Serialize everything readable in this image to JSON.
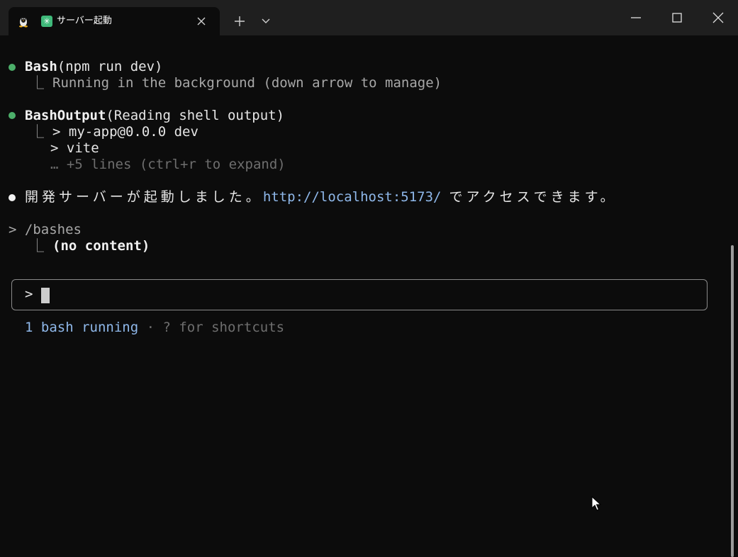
{
  "window": {
    "tab_title": "サーバー起動",
    "tab_app_icon_glyph": "✳",
    "icons": {
      "tab_profile": "linux-tux-icon",
      "tab_app": "asterisk-icon",
      "tab_close": "close-icon",
      "new_tab": "plus-icon",
      "tab_dropdown": "chevron-down-icon",
      "minimize": "minimize-icon",
      "maximize": "maximize-icon",
      "close": "close-icon"
    }
  },
  "terminal": {
    "tree_glyph": "⎿",
    "blocks": {
      "bash": {
        "tool": "Bash",
        "args": "(npm run dev)",
        "result": "Running in the background (down arrow to manage)"
      },
      "bash_output": {
        "tool": "BashOutput",
        "args": "(Reading shell output)",
        "line1": "> my-app@0.0.0 dev",
        "line2": "> vite",
        "more": "… +5 lines (ctrl+r to expand)"
      },
      "message": {
        "prefix": "開発サーバーが起動しました。",
        "url": "http://localhost:5173/",
        "suffix": " でアクセスできます。"
      },
      "command": {
        "text": "> /bashes",
        "result": "(no content)"
      }
    },
    "input": {
      "prompt": ">",
      "value": ""
    },
    "status": {
      "running": "1 bash running",
      "separator": " · ",
      "hint": "? for shortcuts"
    }
  },
  "colors": {
    "background": "#0c0c0c",
    "titlebar": "#1f1f1f",
    "success_bullet": "#4caf6a",
    "link": "#8fb8ea",
    "app_icon": "#3fb97a"
  }
}
